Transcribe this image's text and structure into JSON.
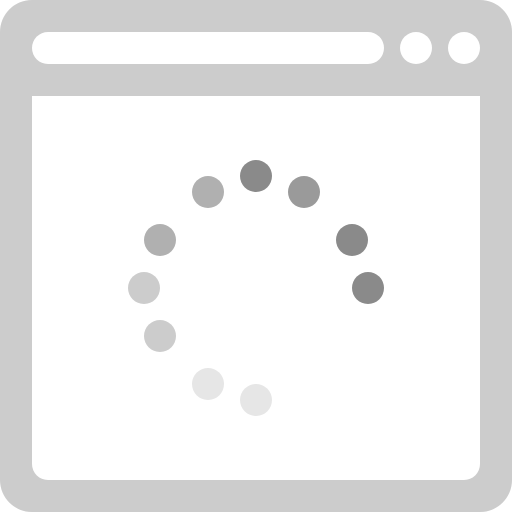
{
  "window": {
    "icon": "browser-window-icon"
  },
  "address_bar": {
    "value": ""
  },
  "window_buttons": [
    {
      "icon": "window-control-button"
    },
    {
      "icon": "window-control-button"
    }
  ],
  "loading_spinner": {
    "icon": "loading-spinner-icon",
    "dot_colors": [
      "#8a8a8a",
      "#9a9a9a",
      "#8a8a8a",
      "#8a8a8a",
      "#e6e6e6",
      "#e6e6e6",
      "#cccccc",
      "#cccccc",
      "#b0b0b0",
      "#b0b0b0"
    ]
  },
  "colors": {
    "frame": "#cccccc",
    "content": "#ffffff"
  }
}
